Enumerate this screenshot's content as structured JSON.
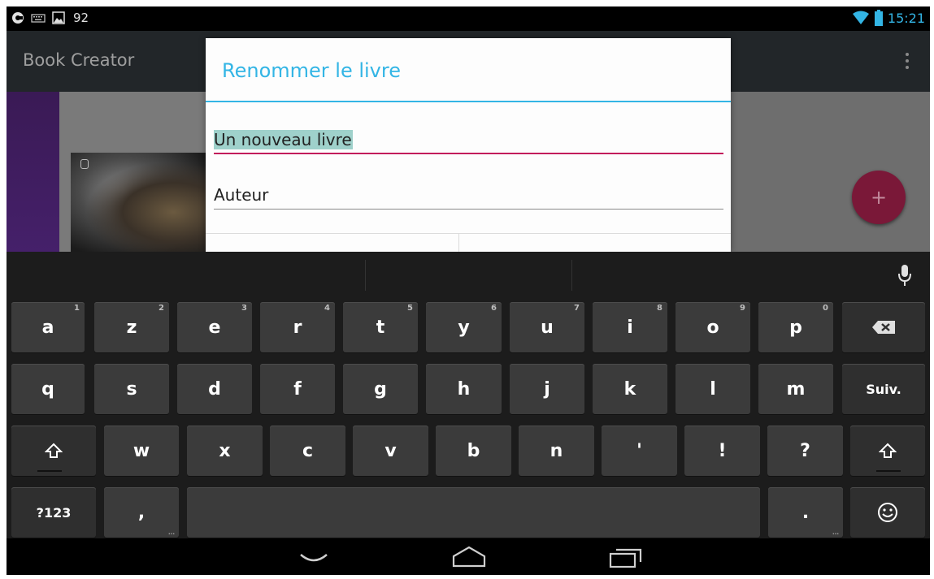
{
  "status_bar": {
    "left_number": "92",
    "time": "15:21",
    "icons": [
      "app-circle-icon",
      "keyboard-icon",
      "image-icon",
      "wifi-icon",
      "battery-icon"
    ]
  },
  "app_bar": {
    "title": "Book Creator"
  },
  "dialog": {
    "title": "Renommer le livre",
    "title_field": {
      "value": "Un nouveau livre",
      "selected": true
    },
    "author_field": {
      "value": "Auteur"
    }
  },
  "keyboard": {
    "row1": [
      {
        "label": "a",
        "hint": "1"
      },
      {
        "label": "z",
        "hint": "2"
      },
      {
        "label": "e",
        "hint": "3"
      },
      {
        "label": "r",
        "hint": "4"
      },
      {
        "label": "t",
        "hint": "5"
      },
      {
        "label": "y",
        "hint": "6"
      },
      {
        "label": "u",
        "hint": "7"
      },
      {
        "label": "i",
        "hint": "8"
      },
      {
        "label": "o",
        "hint": "9"
      },
      {
        "label": "p",
        "hint": "0"
      }
    ],
    "row2": [
      "q",
      "s",
      "d",
      "f",
      "g",
      "h",
      "j",
      "k",
      "l",
      "m"
    ],
    "row3": [
      "w",
      "x",
      "c",
      "v",
      "b",
      "n",
      "'",
      "!",
      "?"
    ],
    "next_label": "Suiv.",
    "symbols_label": "?123",
    "comma_label": ",",
    "period_label": "."
  },
  "colors": {
    "accent_blue": "#33b5e5",
    "accent_pink": "#c2185b",
    "selection": "#9fd1cb",
    "fab": "#7a1838"
  }
}
